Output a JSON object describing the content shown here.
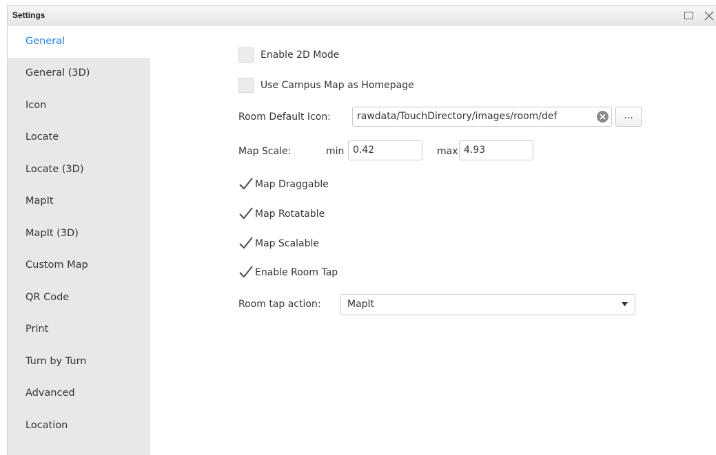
{
  "window": {
    "title": "Settings",
    "maximize_icon": "maximize-icon",
    "close_icon": "close-icon"
  },
  "sidebar": {
    "items": [
      {
        "label": "General",
        "active": true
      },
      {
        "label": "General (3D)"
      },
      {
        "label": "Icon"
      },
      {
        "label": "Locate"
      },
      {
        "label": "Locate (3D)"
      },
      {
        "label": "MapIt"
      },
      {
        "label": "MapIt (3D)"
      },
      {
        "label": "Custom Map"
      },
      {
        "label": "QR Code"
      },
      {
        "label": "Print"
      },
      {
        "label": "Turn by Turn"
      },
      {
        "label": "Advanced"
      },
      {
        "label": "Location"
      }
    ]
  },
  "general": {
    "enable_2d_mode": {
      "label": "Enable 2D Mode",
      "checked": false
    },
    "use_campus_map": {
      "label": "Use Campus Map as Homepage",
      "checked": false
    },
    "room_default_icon": {
      "label": "Room Default Icon:",
      "value": "rawdata/TouchDirectory/images/room/def",
      "browse_label": "..."
    },
    "map_scale": {
      "label": "Map Scale:",
      "min_label": "min",
      "min_value": "0.42",
      "max_label": "max",
      "max_value": "4.93"
    },
    "map_draggable": {
      "label": "Map Draggable",
      "checked": true
    },
    "map_rotatable": {
      "label": "Map Rotatable",
      "checked": true
    },
    "map_scalable": {
      "label": "Map Scalable",
      "checked": true
    },
    "enable_room_tap": {
      "label": "Enable Room Tap",
      "checked": true
    },
    "room_tap_action": {
      "label": "Room tap action:",
      "value": "MapIt"
    }
  },
  "colors": {
    "accent": "#1e7ee6",
    "sidebar_bg": "#e8e8e8"
  }
}
